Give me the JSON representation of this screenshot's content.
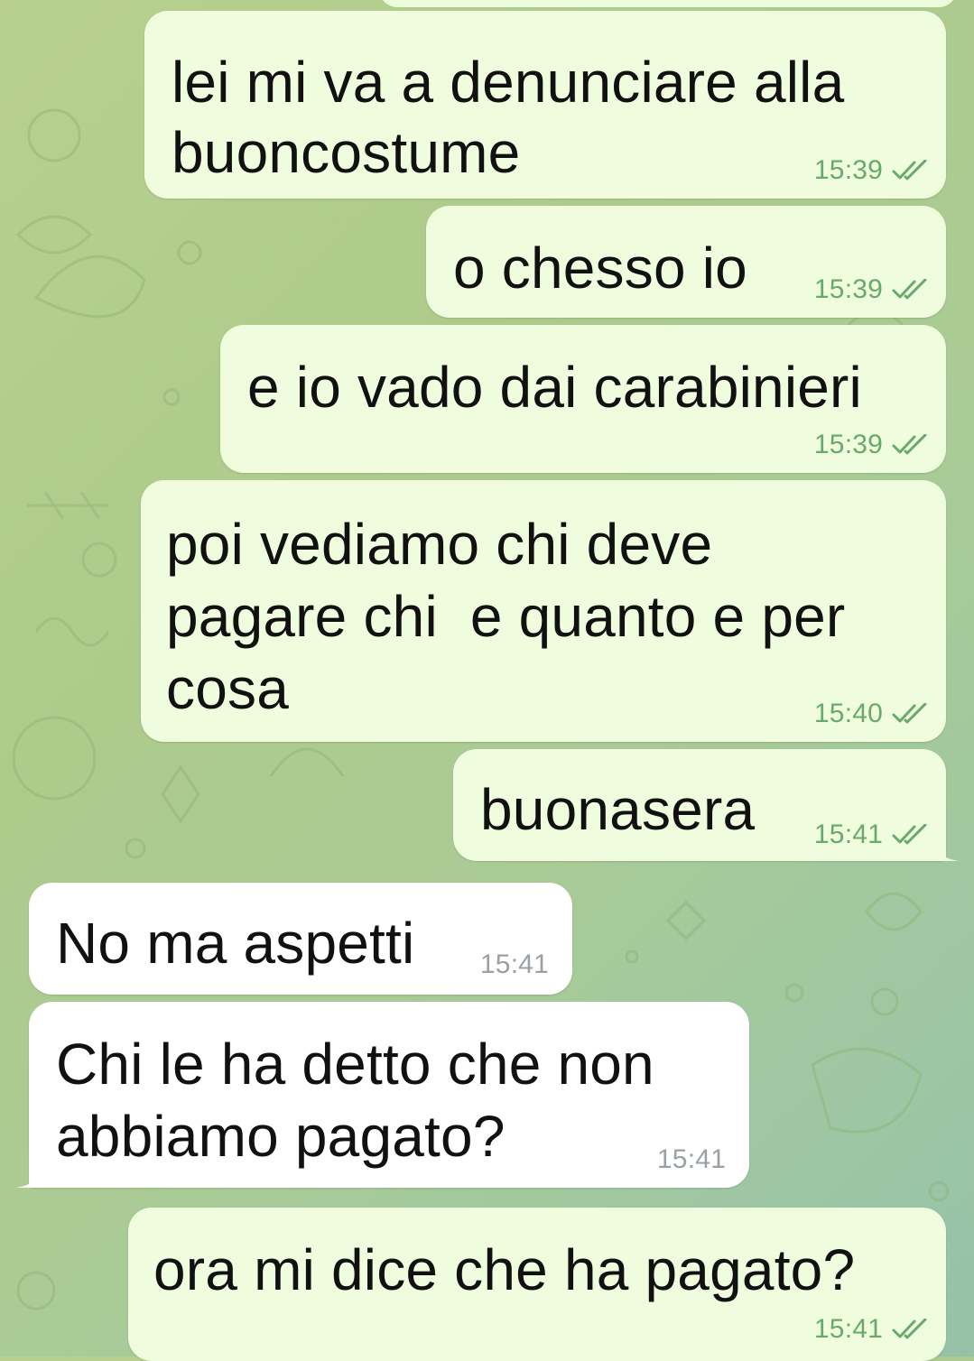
{
  "chat": {
    "messages": [
      {
        "direction": "outgoing",
        "lines": [
          "lei mi va a denunciare alla",
          "buoncostume"
        ],
        "time": "15:39",
        "read": true
      },
      {
        "direction": "outgoing",
        "lines": [
          "o chesso io"
        ],
        "time": "15:39",
        "read": true
      },
      {
        "direction": "outgoing",
        "lines": [
          "e io vado dai carabinieri"
        ],
        "time": "15:39",
        "read": true
      },
      {
        "direction": "outgoing",
        "lines": [
          "poi vediamo chi deve",
          "pagare chi  e quanto e per",
          "cosa"
        ],
        "time": "15:40",
        "read": true
      },
      {
        "direction": "outgoing",
        "lines": [
          "buonasera"
        ],
        "time": "15:41",
        "read": true
      },
      {
        "direction": "incoming",
        "lines": [
          "No ma aspetti"
        ],
        "time": "15:41"
      },
      {
        "direction": "incoming",
        "lines": [
          "Chi le ha detto che non",
          "abbiamo pagato?"
        ],
        "time": "15:41"
      },
      {
        "direction": "outgoing",
        "lines": [
          "ora mi dice che ha pagato?"
        ],
        "time": "15:41",
        "read": true
      }
    ]
  },
  "colors": {
    "outgoing_bubble": "#effdde",
    "incoming_bubble": "#ffffff",
    "read_tick": "#6aa96c",
    "incoming_time": "#9aa0a4",
    "wallpaper_start": "#b7d08f",
    "wallpaper_end": "#95c1a8"
  },
  "icons": {
    "read_receipt": "double-check-icon"
  }
}
